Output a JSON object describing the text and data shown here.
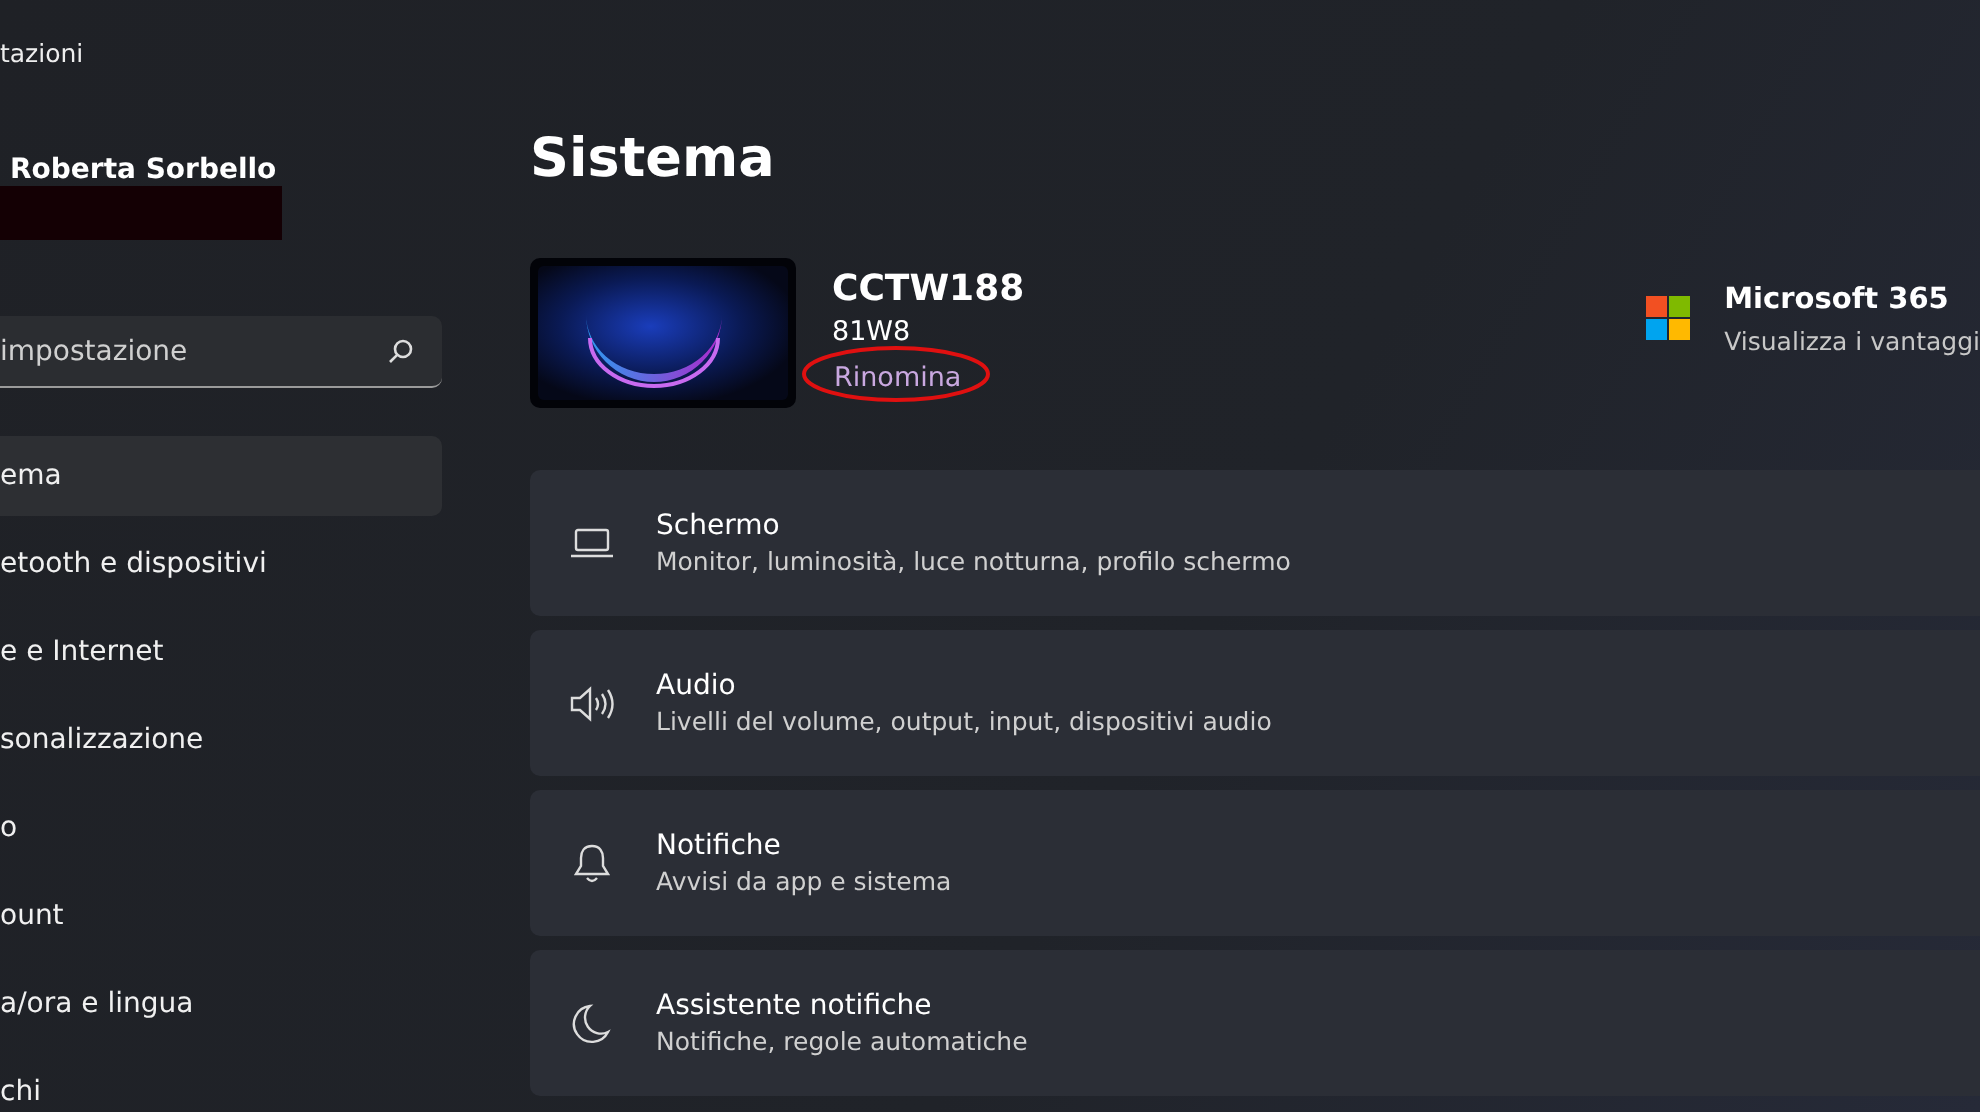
{
  "window": {
    "title": "tazioni"
  },
  "account": {
    "name": "Roberta Sorbello"
  },
  "search": {
    "placeholder": "impostazione"
  },
  "nav": [
    {
      "label": "ema",
      "selected": true
    },
    {
      "label": "etooth e dispositivi",
      "selected": false
    },
    {
      "label": "e e Internet",
      "selected": false
    },
    {
      "label": "sonalizzazione",
      "selected": false
    },
    {
      "label": "o",
      "selected": false
    },
    {
      "label": "ount",
      "selected": false
    },
    {
      "label": "a/ora e lingua",
      "selected": false
    },
    {
      "label": "chi",
      "selected": false
    }
  ],
  "page_title": "Sistema",
  "device": {
    "name": "CCTW188",
    "model": "81W8",
    "rename_link": "Rinomina"
  },
  "promo": {
    "title": "Microsoft 365",
    "subtitle": "Visualizza i vantaggi"
  },
  "settings": [
    {
      "kind": "display",
      "title": "Schermo",
      "description": "Monitor, luminosità, luce notturna, profilo schermo"
    },
    {
      "kind": "sound",
      "title": "Audio",
      "description": "Livelli del volume, output, input, dispositivi audio"
    },
    {
      "kind": "bell",
      "title": "Notifiche",
      "description": "Avvisi da app e sistema"
    },
    {
      "kind": "moon",
      "title": "Assistente notifiche",
      "description": "Notifiche, regole automatiche"
    }
  ]
}
